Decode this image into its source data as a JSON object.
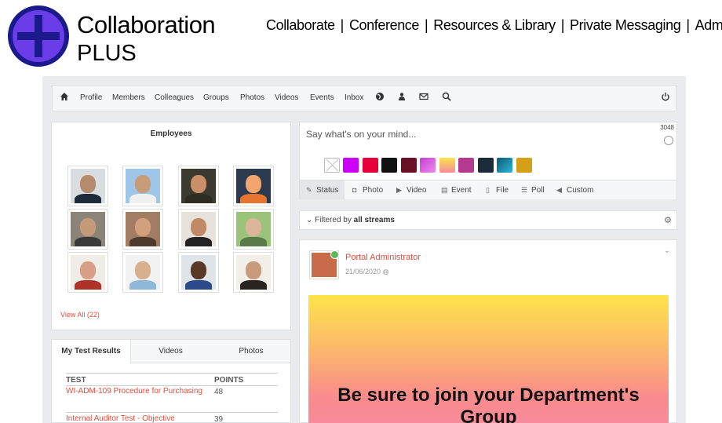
{
  "brand": {
    "line1": "Collaboration",
    "line2": "PLUS"
  },
  "topnav": {
    "items": [
      "Collaborate",
      "Conference",
      "Resources & Library",
      "Private Messaging",
      "Admin"
    ],
    "separator": "|"
  },
  "navbar": {
    "items": [
      "Profile",
      "Members",
      "Colleagues",
      "Groups",
      "Photos",
      "Videos",
      "Events",
      "Inbox"
    ],
    "icons": [
      "home-icon",
      "globe-icon",
      "people-icon",
      "mail-icon",
      "search-icon",
      "power-icon"
    ]
  },
  "employees": {
    "title": "Employees",
    "view_all": "View All (22)"
  },
  "tabs": [
    "My Test Results",
    "Videos",
    "Photos"
  ],
  "results": {
    "headers": [
      "TEST",
      "POINTS"
    ],
    "rows": [
      {
        "test": "WI-ADM-109 Procedure for Purchasing",
        "points": "48"
      },
      {
        "test": "Internal Auditor Test - Objective",
        "points": "39"
      }
    ]
  },
  "composer": {
    "placeholder": "Say what's on your mind...",
    "counter": "3048",
    "tabs": [
      "Status",
      "Photo",
      "Video",
      "Event",
      "File",
      "Poll",
      "Custom"
    ],
    "swatch_colors": [
      "none",
      "#cc00ff",
      "#e8003a",
      "#111111",
      "#6b0f24",
      "#d94fd9",
      "#f6a05f",
      "#b43a8f",
      "#1c2c3a",
      "#1a7f9b",
      "#d4a017"
    ]
  },
  "filter": {
    "prefix": "Filtered by",
    "value": "all streams"
  },
  "post": {
    "author": "Portal Administrator",
    "date": "21/06/2020",
    "banner_text": "Be sure to join your Department's Group"
  },
  "colors": {
    "accent": "#e74c3c",
    "logo_fill": "#6a3de8",
    "logo_ring": "#1a1a8c"
  }
}
